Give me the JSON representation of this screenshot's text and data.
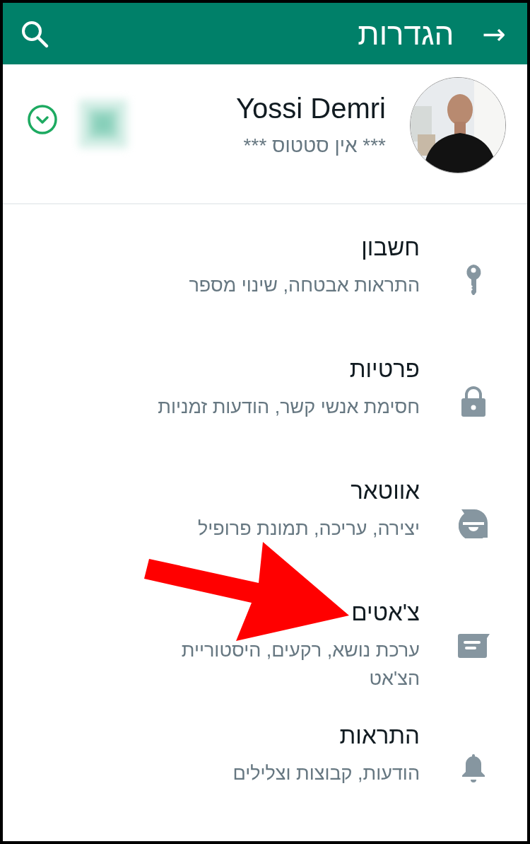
{
  "header": {
    "title": "הגדרות",
    "back_icon": "→"
  },
  "profile": {
    "name": "Yossi Demri",
    "status": "*** אין סטטוס ***"
  },
  "settings": [
    {
      "kind": "key",
      "title": "חשבון",
      "subtitle": "התראות אבטחה, שינוי מספר"
    },
    {
      "kind": "lock",
      "title": "פרטיות",
      "subtitle": "חסימת אנשי קשר, הודעות זמניות"
    },
    {
      "kind": "avatar",
      "title": "אווטאר",
      "subtitle": "יצירה, עריכה, תמונת פרופיל"
    },
    {
      "kind": "chat",
      "title": "צ'אטים",
      "subtitle": "ערכת נושא, רקעים, היסטוריית הצ'אט"
    },
    {
      "kind": "bell",
      "title": "התראות",
      "subtitle": "הודעות, קבוצות וצלילים"
    }
  ],
  "annotation": {
    "kind": "arrow"
  }
}
